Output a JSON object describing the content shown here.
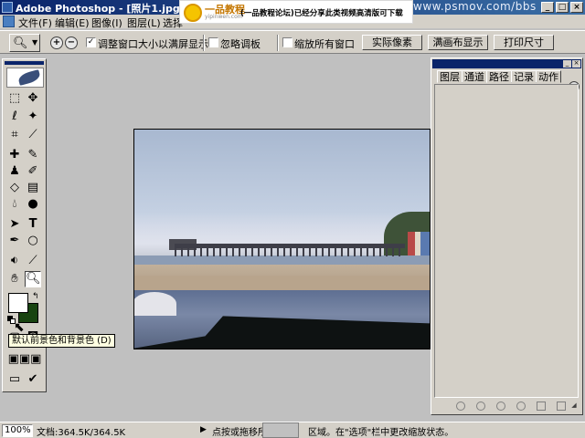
{
  "window": {
    "title": "Adobe Photoshop - [照片1.jpg @ 100%(",
    "watermark_url": "www.psmov.com/bbs",
    "controls": {
      "minimize": "_",
      "maximize": "□",
      "close": "×"
    }
  },
  "banner": {
    "logo": "一品教程",
    "logo_sub": "yipinwen.com",
    "slogan": "(一品教程论坛)已经分享此类视频高清版可下载"
  },
  "menu": {
    "items": [
      "文件(F)",
      "编辑(E)",
      "图像(I)",
      "图层(L)",
      "选择"
    ]
  },
  "options": {
    "zoom_in": "+",
    "zoom_out": "−",
    "resize_windows": {
      "label": "调整窗口大小以满屏显示",
      "checked": true
    },
    "ignore_palettes": {
      "label": "忽略调板",
      "checked": false
    },
    "zoom_all": {
      "label": "缩放所有窗口",
      "checked": false
    },
    "buttons": {
      "actual_pixels": "实际像素",
      "fit_screen": "满画布显示",
      "print_size": "打印尺寸"
    }
  },
  "toolbox": {
    "tools": [
      "marquee",
      "move",
      "lasso",
      "magic-wand",
      "crop",
      "slice",
      "healing-brush",
      "brush",
      "clone-stamp",
      "history-brush",
      "eraser",
      "gradient",
      "blur",
      "dodge",
      "path-selection",
      "type",
      "pen",
      "shape",
      "notes",
      "eyedropper",
      "hand",
      "zoom"
    ],
    "active_tool": "zoom",
    "foreground_color": "#ffffff",
    "background_color": "#184410",
    "tooltip": "默认前景色和背景色 (D)"
  },
  "panel": {
    "tabs": [
      "图层",
      "通道",
      "路径",
      "记录",
      "动作"
    ],
    "active_tab": "路径"
  },
  "status": {
    "zoom": "100%",
    "doc_size": "文档:364.5K/364.5K",
    "hint_start": "点按或拖移所",
    "hint_end": "区域。在\"选项\"栏中更改缩放状态。"
  }
}
